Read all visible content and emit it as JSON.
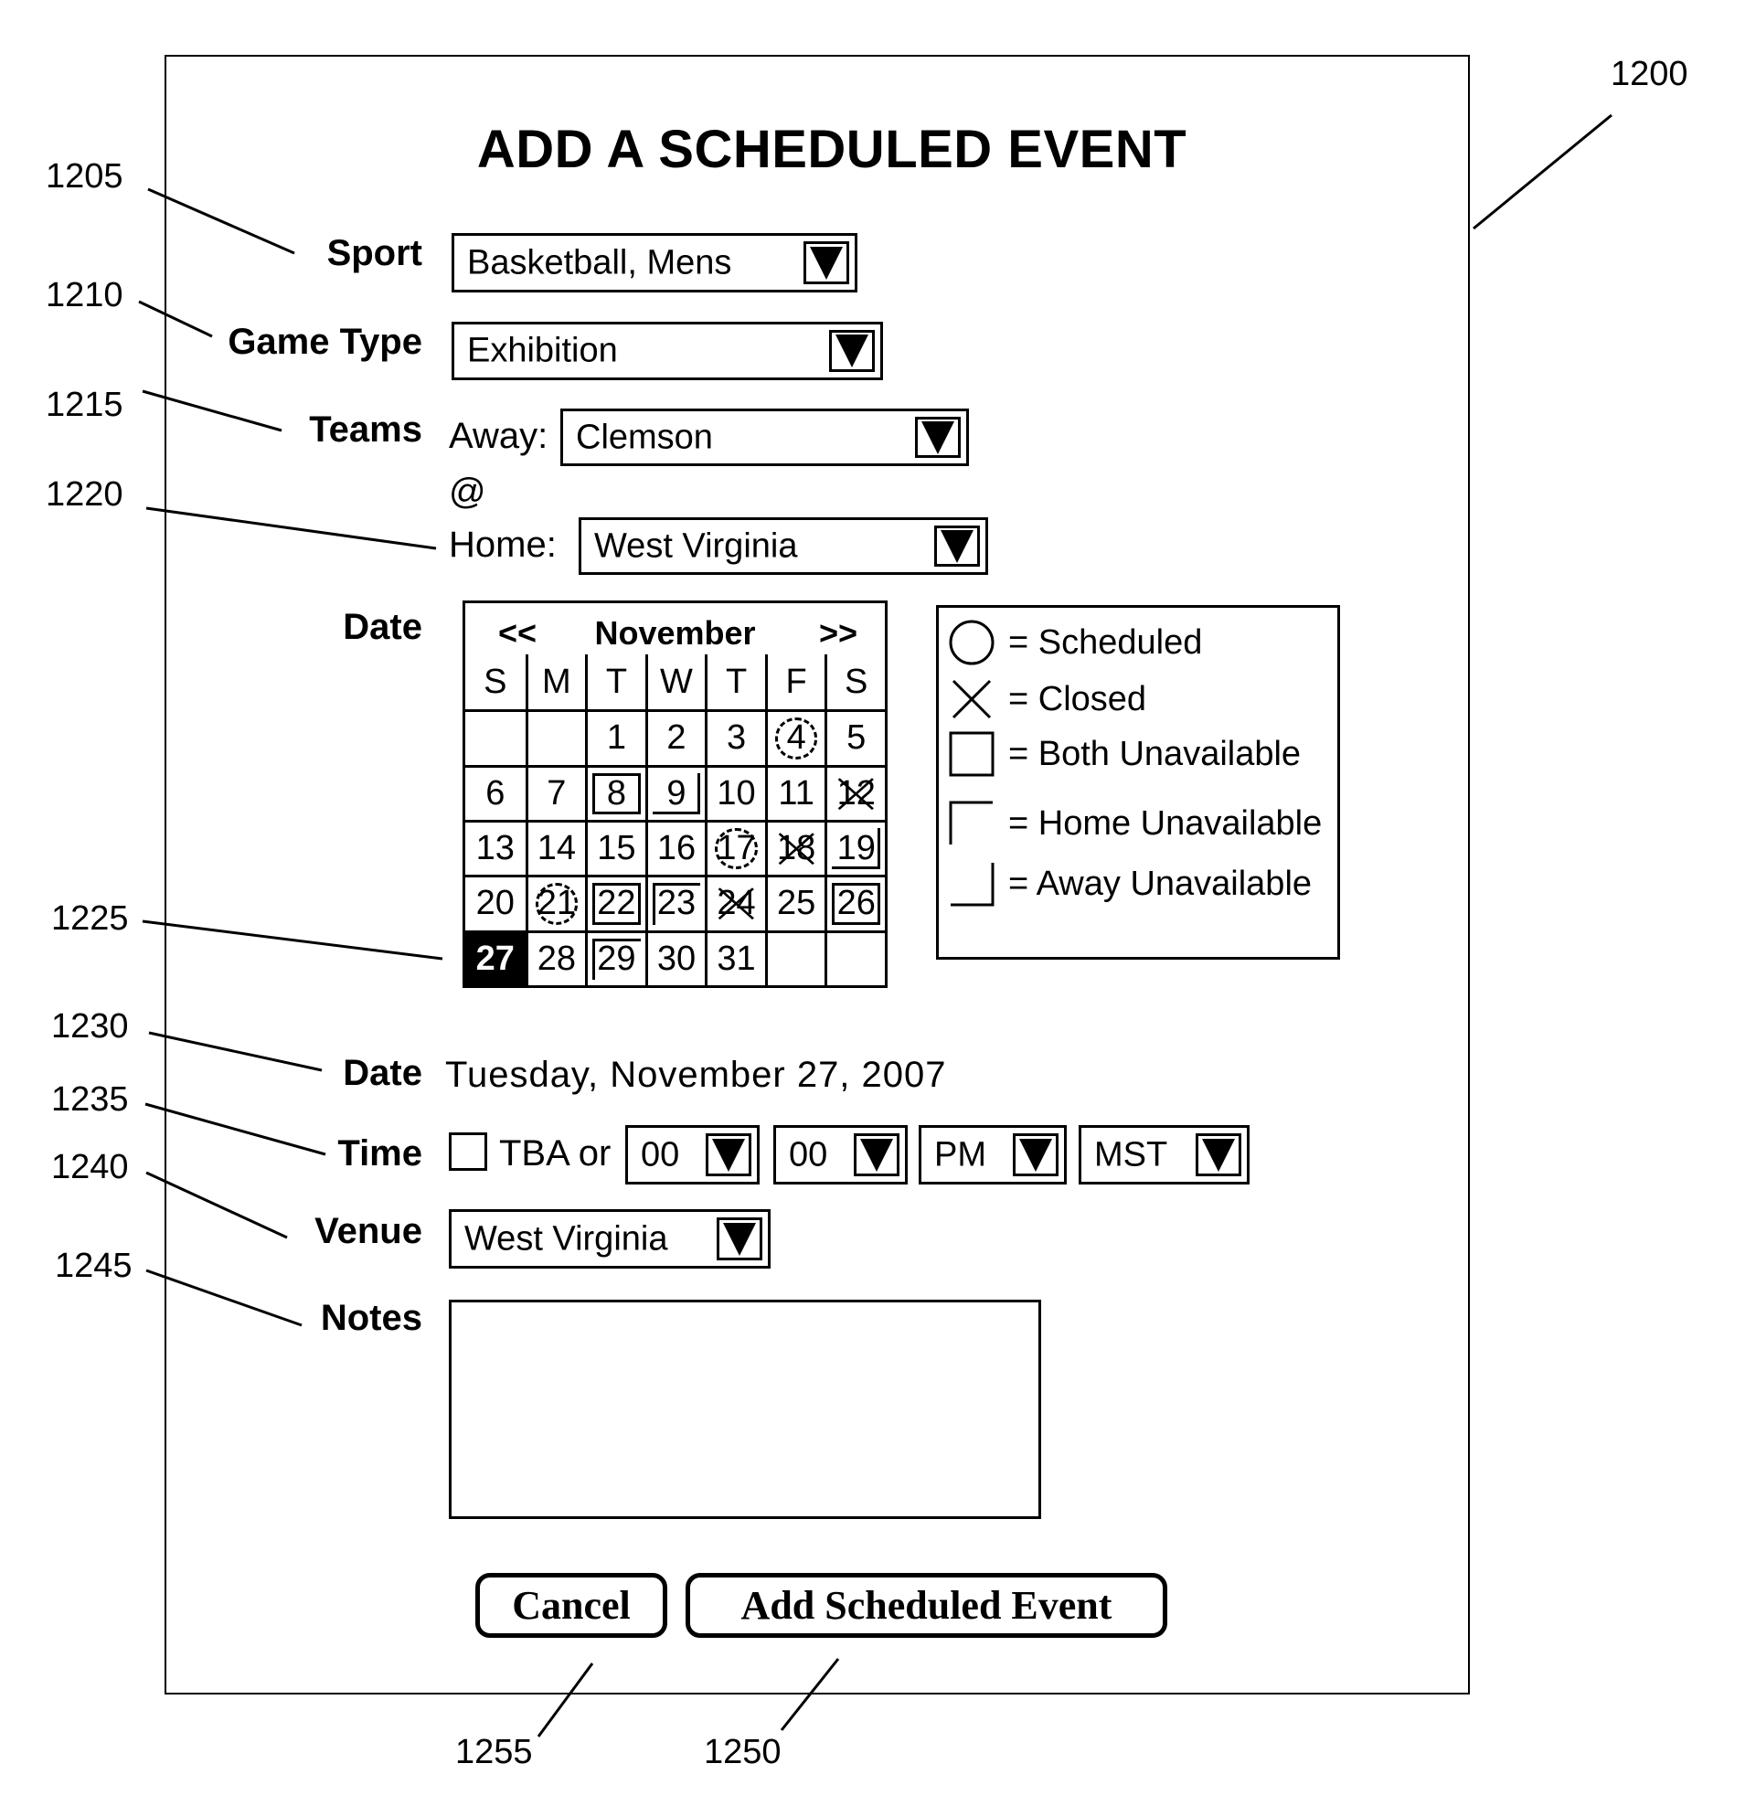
{
  "figure": {
    "ref_numbers": {
      "dialog": "1200",
      "sport": "1205",
      "game_type": "1210",
      "teams": "1215",
      "home": "1220",
      "calendar_selected": "1225",
      "date_text": "1230",
      "time": "1235",
      "venue": "1240",
      "notes": "1245",
      "add_button": "1250",
      "cancel_button": "1255"
    }
  },
  "dialog": {
    "title": "ADD A SCHEDULED EVENT"
  },
  "form": {
    "sport": {
      "label": "Sport",
      "value": "Basketball, Mens"
    },
    "game_type": {
      "label": "Game Type",
      "value": "Exhibition"
    },
    "teams": {
      "label": "Teams",
      "away_label": "Away:",
      "away_value": "Clemson",
      "at_symbol": "@",
      "home_label": "Home:",
      "home_value": "West Virginia"
    },
    "date_picker": {
      "label": "Date",
      "prev": "<<",
      "month": "November",
      "next": ">>",
      "weekdays": [
        "S",
        "M",
        "T",
        "W",
        "T",
        "F",
        "S"
      ],
      "first_weekday_index": 2,
      "days_in_month": 31,
      "selected_day": 27,
      "marks": {
        "scheduled": [
          4,
          17,
          21
        ],
        "closed": [
          12,
          18,
          24
        ],
        "both_unavailable": [
          8,
          22,
          26
        ],
        "home_unavailable": [
          23,
          29
        ],
        "away_unavailable": [
          9,
          19
        ]
      }
    },
    "legend": [
      {
        "symbol": "circle-icon",
        "label": "= Scheduled"
      },
      {
        "symbol": "x-icon",
        "label": "= Closed"
      },
      {
        "symbol": "box-icon",
        "label": "= Both Unavailable"
      },
      {
        "symbol": "home-corner-icon",
        "label": "= Home Unavailable"
      },
      {
        "symbol": "away-corner-icon",
        "label": "= Away Unavailable"
      }
    ],
    "date_text": {
      "label": "Date",
      "value": "Tuesday, November 27, 2007"
    },
    "time": {
      "label": "Time",
      "tba_checked": false,
      "tba_label": "TBA or",
      "hour": "00",
      "minute": "00",
      "ampm": "PM",
      "timezone": "MST"
    },
    "venue": {
      "label": "Venue",
      "value": "West Virginia"
    },
    "notes": {
      "label": "Notes",
      "value": ""
    }
  },
  "buttons": {
    "cancel": "Cancel",
    "add": "Add Scheduled Event"
  }
}
